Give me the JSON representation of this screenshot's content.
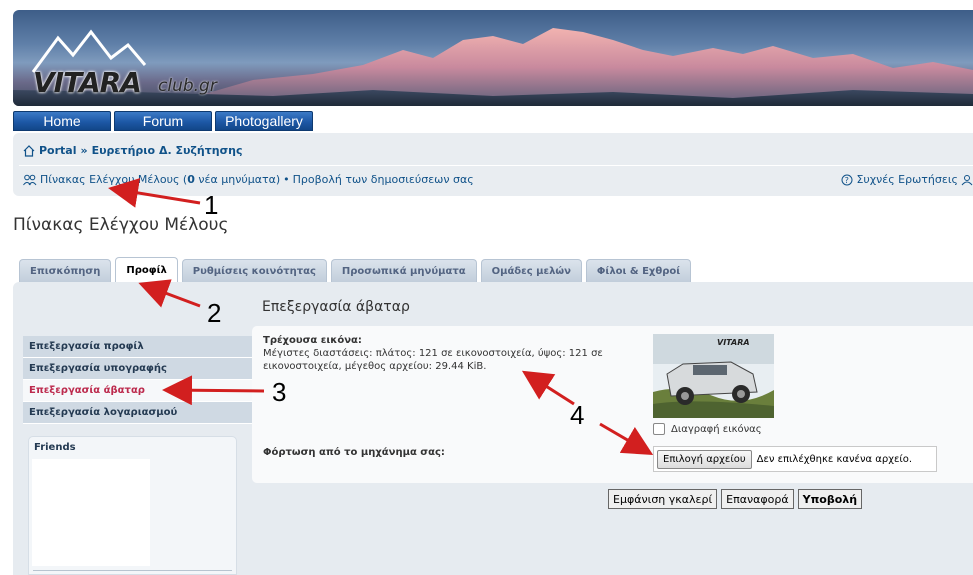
{
  "header": {
    "logo_main": "VITARA",
    "logo_suffix": "club.gr"
  },
  "nav": [
    {
      "label": "Home"
    },
    {
      "label": "Forum"
    },
    {
      "label": "Photogallery"
    }
  ],
  "breadcrumb": {
    "portal": "Portal",
    "separator": "»",
    "index": "Ευρετήριο Δ. Συζήτησης"
  },
  "user_links": {
    "ucp_prefix": "Πίνακας Ελέγχου Μέλους (",
    "new_count": "0",
    "ucp_suffix": " νέα μηνύματα)",
    "bullet": "•",
    "view_posts": "Προβολή των δημοσιεύσεων σας",
    "faq": "Συχνές Ερωτήσεις"
  },
  "page_title": "Πίνακας Ελέγχου Μέλους",
  "tabs": [
    {
      "label": "Επισκόπηση"
    },
    {
      "label": "Προφίλ"
    },
    {
      "label": "Ρυθμίσεις κοινότητας"
    },
    {
      "label": "Προσωπικά μηνύματα"
    },
    {
      "label": "Ομάδες μελών"
    },
    {
      "label": "Φίλοι & Εχθροί"
    }
  ],
  "sidebar": {
    "items": [
      {
        "label": "Επεξεργασία προφίλ"
      },
      {
        "label": "Επεξεργασία υπογραφής"
      },
      {
        "label": "Επεξεργασία άβαταρ"
      },
      {
        "label": "Επεξεργασία λογαριασμού"
      }
    ],
    "friends_title": "Friends"
  },
  "content": {
    "title": "Επεξεργασία άβαταρ",
    "current_label": "Τρέχουσα εικόνα:",
    "current_desc": "Μέγιστες διαστάσεις: πλάτος: 121 σε εικονοστοιχεία, ύψος: 121 σε εικονοστοιχεία, μέγεθος αρχείου: 29.44 KiB.",
    "avatar_caption": "VITARA",
    "delete_label": "Διαγραφή εικόνας",
    "upload_label": "Φόρτωση από το μηχάνημα σας:",
    "file_button": "Επιλογή αρχείου",
    "file_status": "Δεν επιλέχθηκε κανένα αρχείο."
  },
  "buttons": {
    "gallery": "Εμφάνιση γκαλερί",
    "reset": "Επαναφορά",
    "submit": "Υποβολή"
  },
  "annotations": [
    "1",
    "2",
    "3",
    "4"
  ],
  "colors": {
    "link": "#105289",
    "active_menu": "#bc2a4d",
    "nav_button": "#1d58a6",
    "arrow": "#d21f1f"
  }
}
